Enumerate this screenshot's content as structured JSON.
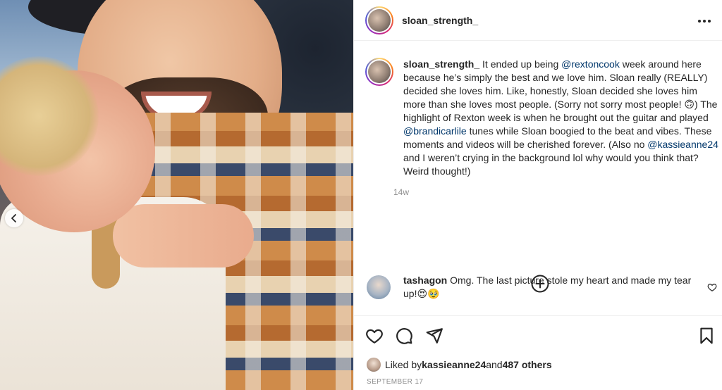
{
  "header": {
    "username": "sloan_strength_"
  },
  "caption": {
    "username": "sloan_strength_",
    "parts": [
      {
        "t": "text",
        "v": " It ended up being "
      },
      {
        "t": "mention",
        "v": "@rextoncook"
      },
      {
        "t": "text",
        "v": " week around here because he’s simply the best and we love him. Sloan really (REALLY) decided she loves him. Like, honestly, Sloan decided she loves him more than she loves most people. (Sorry not sorry most people! 🙃) The highlight of Rexton week is when he brought out the guitar and played "
      },
      {
        "t": "mention",
        "v": "@brandicarlile"
      },
      {
        "t": "text",
        "v": " tunes while Sloan boogied to the beat and vibes. These moments and videos will be cherished forever. (Also no "
      },
      {
        "t": "mention",
        "v": "@kassieanne24"
      },
      {
        "t": "text",
        "v": " and I weren’t crying in the background lol why would you think that? Weird thought!)"
      }
    ],
    "time": "14w"
  },
  "comment": {
    "username": "tashagon",
    "text": " Omg. The last picture stole my heart and made my tear up!😍🥹"
  },
  "likes": {
    "prefix": "Liked by ",
    "user": "kassieanne24",
    "middle": " and ",
    "others": "487 others"
  },
  "date": "SEPTEMBER 17",
  "icons": {
    "carousel_prev": "chevron-left-icon",
    "more": "more-horizontal-icon",
    "add_comment": "plus-circle-icon",
    "comment_like": "heart-outline-icon",
    "like": "heart-outline-icon",
    "comment": "comment-bubble-icon",
    "share": "paper-plane-icon",
    "save": "bookmark-icon"
  },
  "colors": {
    "mention": "#00376b",
    "muted": "#8e8e8e",
    "text": "#262626"
  }
}
